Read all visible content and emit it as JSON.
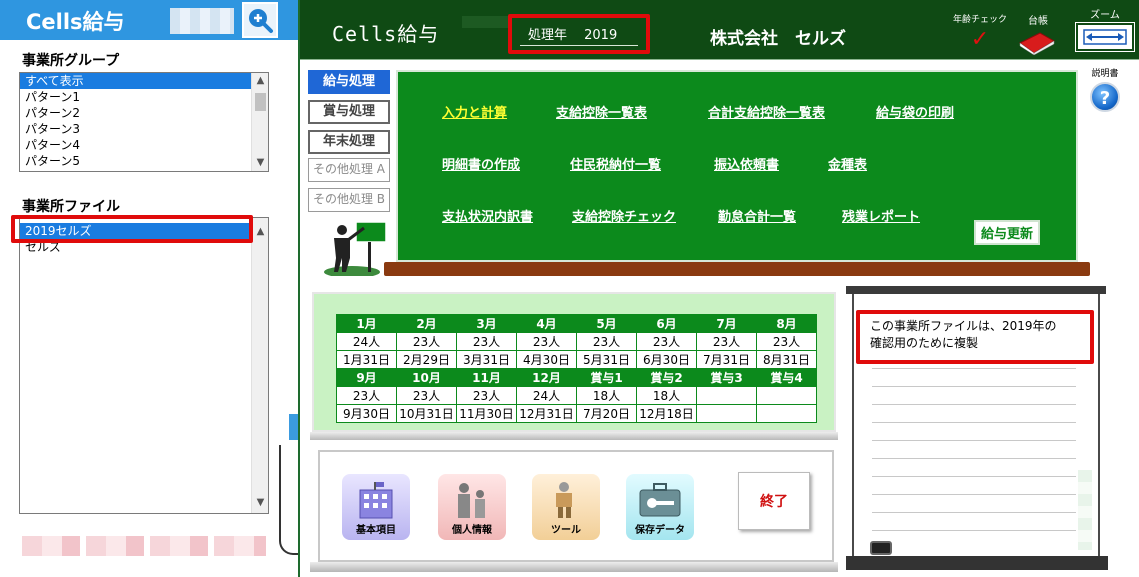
{
  "sidebar": {
    "logo": "Cells給与",
    "group_title": "事業所グループ",
    "group_items": [
      "すべて表示",
      "パターン1",
      "パターン2",
      "パターン3",
      "パターン4",
      "パターン5"
    ],
    "group_selected_index": 0,
    "file_title": "事業所ファイル",
    "file_items": [
      "2019セルズ",
      "セルズ"
    ],
    "file_selected_index": 0
  },
  "header": {
    "app_title": "Cells給与",
    "year_field": "処理年　 2019",
    "company": "株式会社　セルズ",
    "age_check_label": "年齢チェック",
    "age_check_mark": "✓",
    "ledger_label": "台帳",
    "zoom_label": "ズーム"
  },
  "help": {
    "label": "説明書",
    "icon": "?"
  },
  "side_tabs": [
    {
      "label": "給与処理",
      "state": "active"
    },
    {
      "label": "賞与処理",
      "state": "normal"
    },
    {
      "label": "年末処理",
      "state": "normal"
    },
    {
      "label": "その他処理 A",
      "state": "dim"
    },
    {
      "label": "その他処理 B",
      "state": "dim"
    }
  ],
  "menu": {
    "row1": [
      "入力と計算",
      "支給控除一覧表",
      "合計支給控除一覧表",
      "給与袋の印刷"
    ],
    "row2": [
      "明細書の作成",
      "住民税納付一覧",
      "振込依頼書",
      "金種表"
    ],
    "row3": [
      "支払状況内訳書",
      "支給控除チェック",
      "勤怠合計一覧",
      "残業レポート"
    ],
    "update_button": "給与更新"
  },
  "calendar": {
    "row1_heads": [
      "1月",
      "2月",
      "3月",
      "4月",
      "5月",
      "6月",
      "7月",
      "8月"
    ],
    "row1_counts": [
      "24人",
      "23人",
      "23人",
      "23人",
      "23人",
      "23人",
      "23人",
      "23人"
    ],
    "row1_dates": [
      "1月31日",
      "2月29日",
      "3月31日",
      "4月30日",
      "5月31日",
      "6月30日",
      "7月31日",
      "8月31日"
    ],
    "row2_heads": [
      "9月",
      "10月",
      "11月",
      "12月",
      "賞与1",
      "賞与2",
      "賞与3",
      "賞与4"
    ],
    "row2_counts": [
      "23人",
      "23人",
      "23人",
      "24人",
      "18人",
      "18人",
      "",
      ""
    ],
    "row2_dates": [
      "9月30日",
      "10月31日",
      "11月30日",
      "12月31日",
      "7月20日",
      "12月18日",
      "",
      ""
    ]
  },
  "tools": {
    "basic": "基本項目",
    "personal": "個人情報",
    "tool": "ツール",
    "save": "保存データ",
    "exit": "終了"
  },
  "note": {
    "text_line1": "この事業所ファイルは、2019年の",
    "text_line2": "確認用のために複製"
  },
  "colors": {
    "sidebar_header": "#2f96e0",
    "top_bar": "#0f4a14",
    "board": "#0c8a1c",
    "highlight": "#e00b0b",
    "link_active": "#ffff33"
  }
}
